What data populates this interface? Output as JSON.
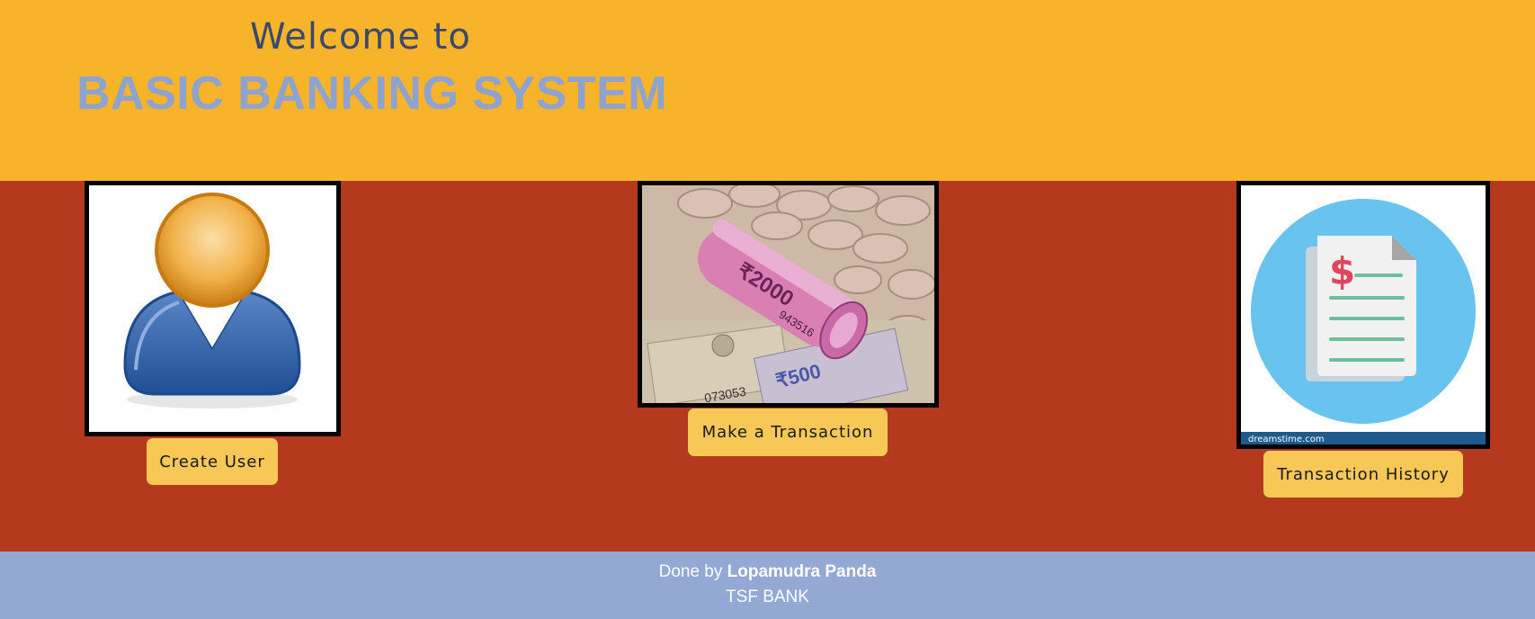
{
  "header": {
    "welcome": "Welcome to",
    "title": "BASIC BANKING SYSTEM"
  },
  "cards": [
    {
      "image": "user-avatar-icon",
      "button_label": "Create User"
    },
    {
      "image": "currency-notes-coins-photo",
      "button_label": "Make a Transaction"
    },
    {
      "image": "transaction-document-icon",
      "button_label": "Transaction History",
      "watermark_left": "dreamstime.com"
    }
  ],
  "footer": {
    "prefix": "Done by",
    "author": "Lopamudra Panda",
    "bank": "TSF BANK"
  },
  "colors": {
    "header_bg": "#f7b42b",
    "main_bg": "#b5391d",
    "footer_bg": "#93a8d2",
    "button_bg": "#f7c856",
    "title_color": "#8ea3cf",
    "welcome_color": "#3b4a6b"
  }
}
